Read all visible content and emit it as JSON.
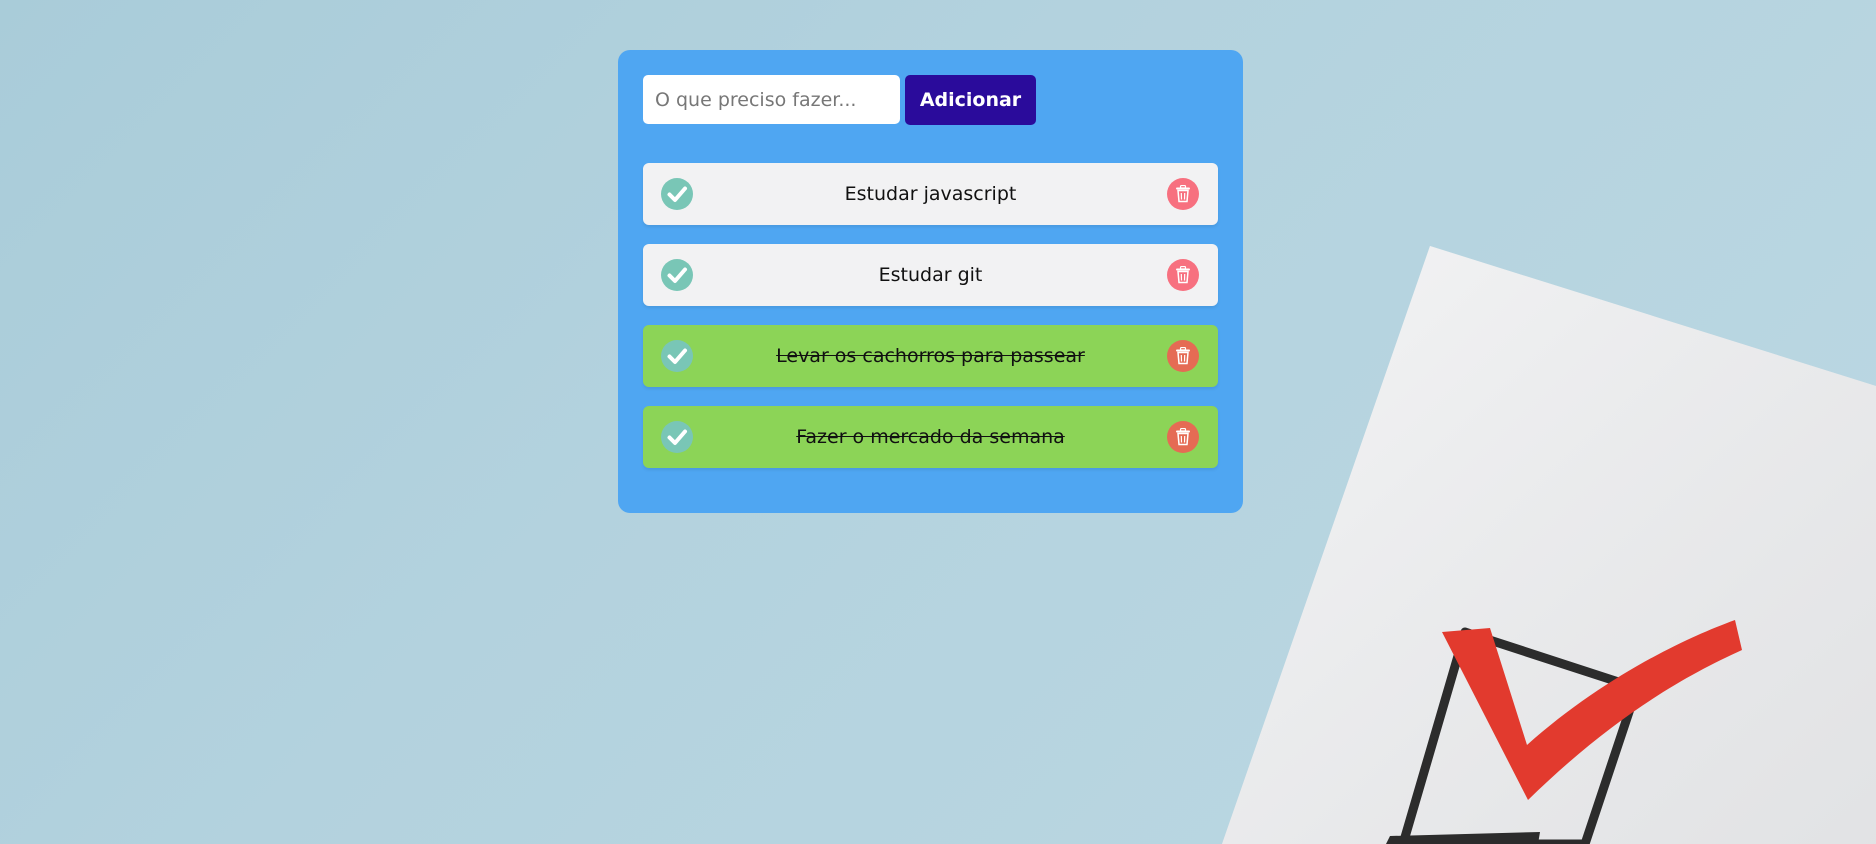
{
  "new_task": {
    "placeholder": "O que preciso fazer...",
    "value": "",
    "add_label": "Adicionar"
  },
  "tasks": [
    {
      "text": "Estudar javascript",
      "done": false
    },
    {
      "text": "Estudar git",
      "done": false
    },
    {
      "text": "Levar os cachorros para passear",
      "done": true
    },
    {
      "text": "Fazer o mercado da semana",
      "done": true
    }
  ],
  "icons": {
    "check": "check-circle-icon",
    "delete": "trash-icon"
  },
  "colors": {
    "card": "#4fa6f2",
    "add_button": "#2a0b9b",
    "task_pending": "#f2f2f3",
    "task_done": "#8cd457",
    "check": "#79c6b6",
    "delete_pending": "#f7707f",
    "delete_done": "#e56b54",
    "checkmark_red": "#e23a2e"
  }
}
